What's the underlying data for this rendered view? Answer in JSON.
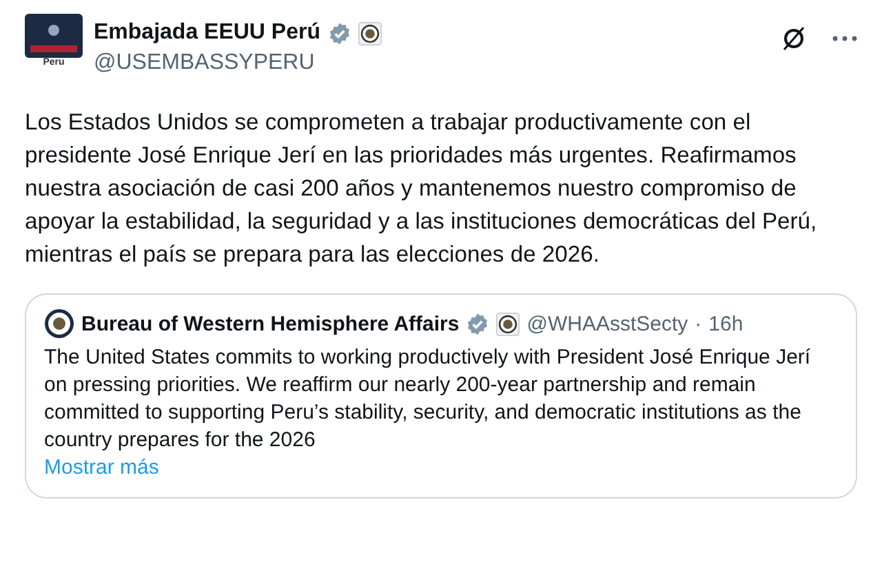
{
  "author": {
    "avatar_label": "Peru",
    "name": "Embajada EEUU Perú",
    "verified": true,
    "handle": "@USEMBASSYPERU"
  },
  "text": "Los Estados Unidos se comprometen a trabajar productivamente con el presidente José Enrique Jerí en las prioridades más urgentes. Reafirmamos nuestra asociación de casi 200 años y mantenemos nuestro compromiso de apoyar la estabilidad, la seguridad y a las instituciones democráticas del Perú, mientras el país se prepara para las elecciones de 2026.",
  "quote": {
    "name": "Bureau of Western Hemisphere Affairs",
    "verified": true,
    "handle": "@WHAAsstSecty",
    "separator": "·",
    "time": "16h",
    "text": "The United States commits to working productively with President José Enrique Jerí on pressing priorities. We reaffirm our nearly 200-year partnership and remain committed to supporting Peru’s stability, security, and democratic institutions as the country prepares for the 2026",
    "more": "Mostrar más"
  }
}
